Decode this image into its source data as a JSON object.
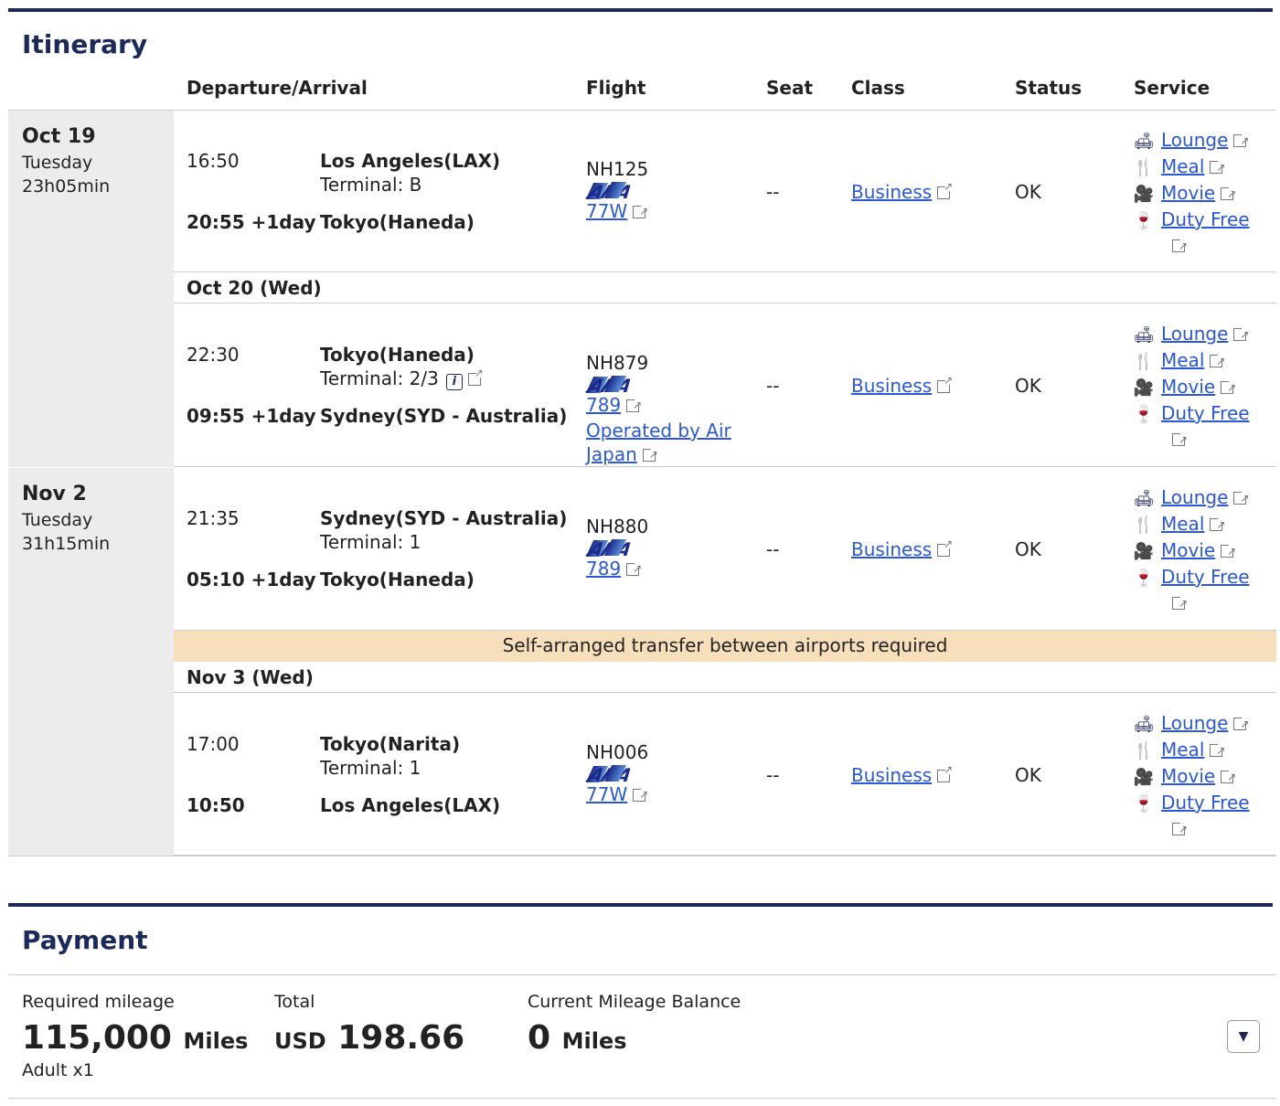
{
  "itinerary": {
    "title": "Itinerary",
    "headers": {
      "dep_arr": "Departure/Arrival",
      "flight": "Flight",
      "seat": "Seat",
      "class": "Class",
      "status": "Status",
      "service": "Service"
    },
    "groups": [
      {
        "date": "Oct 19",
        "day": "Tuesday",
        "duration": "23h05min"
      },
      {
        "date": "Nov 2",
        "day": "Tuesday",
        "duration": "31h15min"
      }
    ],
    "segments": [
      {
        "dep_time": "16:50",
        "dep_city": "Los Angeles(LAX)",
        "terminal": "Terminal: B",
        "arr_time": "20:55 +1day",
        "arr_city": "Tokyo(Haneda)",
        "flight": "NH125",
        "aircraft": "77W",
        "operated": "",
        "seat": "--",
        "class": "Business",
        "status": "OK"
      },
      {
        "dep_time": "22:30",
        "dep_city": "Tokyo(Haneda)",
        "terminal": "Terminal: 2/3",
        "arr_time": "09:55 +1day",
        "arr_city": "Sydney(SYD - Australia)",
        "flight": "NH879",
        "aircraft": "789",
        "operated": "Operated by Air Japan",
        "seat": "--",
        "class": "Business",
        "status": "OK"
      },
      {
        "dep_time": "21:35",
        "dep_city": "Sydney(SYD - Australia)",
        "terminal": "Terminal: 1",
        "arr_time": "05:10 +1day",
        "arr_city": "Tokyo(Haneda)",
        "flight": "NH880",
        "aircraft": "789",
        "operated": "",
        "seat": "--",
        "class": "Business",
        "status": "OK"
      },
      {
        "dep_time": "17:00",
        "dep_city": "Tokyo(Narita)",
        "terminal": "Terminal: 1",
        "arr_time": "10:50",
        "arr_city": "Los Angeles(LAX)",
        "flight": "NH006",
        "aircraft": "77W",
        "operated": "",
        "seat": "--",
        "class": "Business",
        "status": "OK"
      }
    ],
    "date_rows": [
      "Oct 20 (Wed)",
      "Nov 3 (Wed)"
    ],
    "notice": "Self-arranged transfer between airports required",
    "airline_logo": "ANA",
    "services": [
      "Lounge",
      "Meal",
      "Movie",
      "Duty Free"
    ]
  },
  "payment": {
    "title": "Payment",
    "required_label": "Required mileage",
    "required_value": "115,000",
    "required_unit": "Miles",
    "adult": "Adult x1",
    "total_label": "Total",
    "total_currency": "USD",
    "total_value": "198.66",
    "balance_label": "Current Mileage Balance",
    "balance_value": "0",
    "balance_unit": "Miles"
  },
  "colors": {
    "brand": "#1b2a5a",
    "link": "#2a58d6",
    "notice": "#f7dfbc"
  }
}
